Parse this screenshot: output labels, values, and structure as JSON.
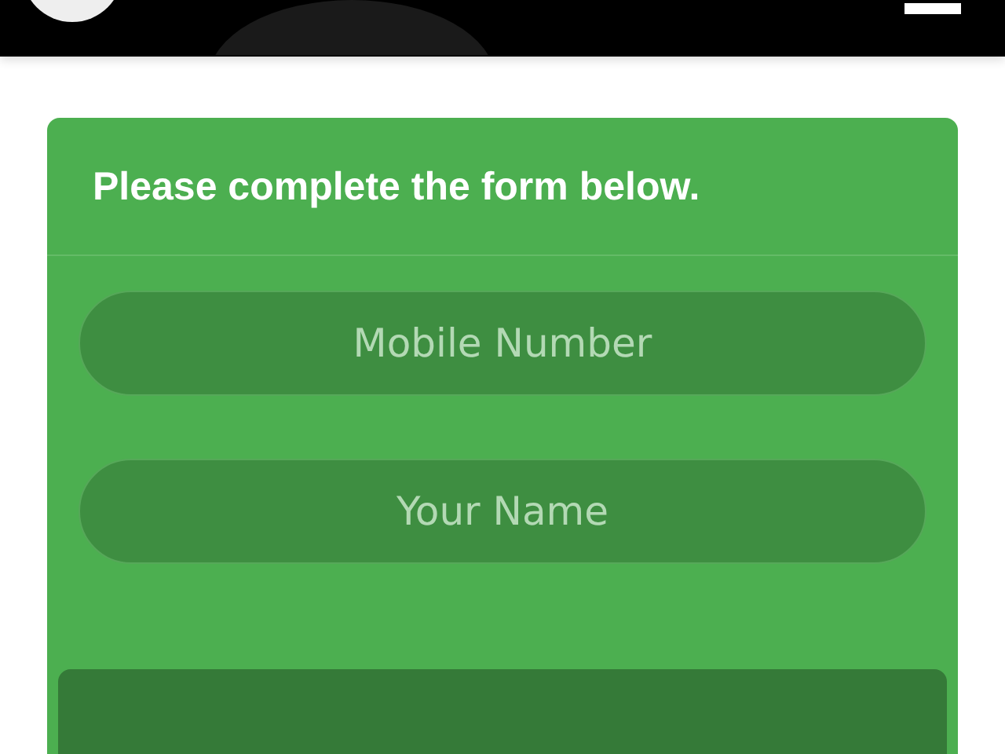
{
  "form": {
    "title": "Please complete the form below.",
    "fields": [
      {
        "placeholder": "Mobile Number"
      },
      {
        "placeholder": "Your Name"
      }
    ]
  }
}
